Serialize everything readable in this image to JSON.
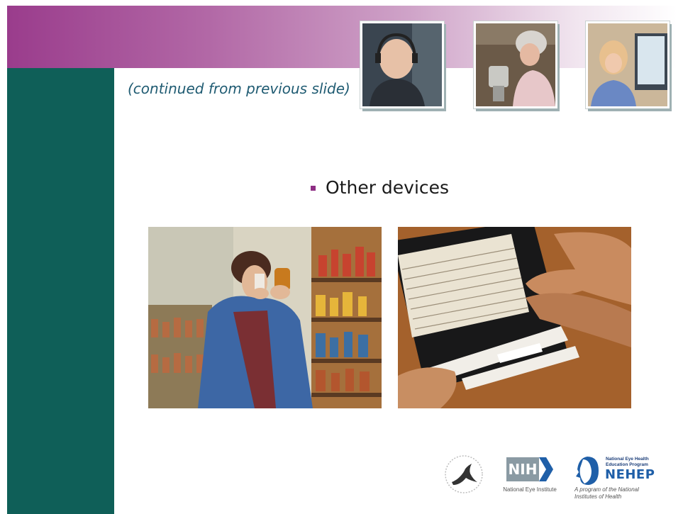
{
  "slide": {
    "continued_note": "(continued from previous slide)",
    "bullet_text": "Other devices"
  },
  "logos": {
    "nih_text": "NIH",
    "nih_caption": "National Eye Institute",
    "nehep_small_line1": "National Eye Health",
    "nehep_small_line2": "Education Program",
    "nehep_big": "NEHEP",
    "nehep_program_line1": "A program of the National",
    "nehep_program_line2": "Institutes of Health"
  },
  "colors": {
    "side_bar": "#0f5f58",
    "band_start": "#9a3c8c",
    "bullet": "#8e2e84",
    "continued_text": "#1f5b72"
  }
}
